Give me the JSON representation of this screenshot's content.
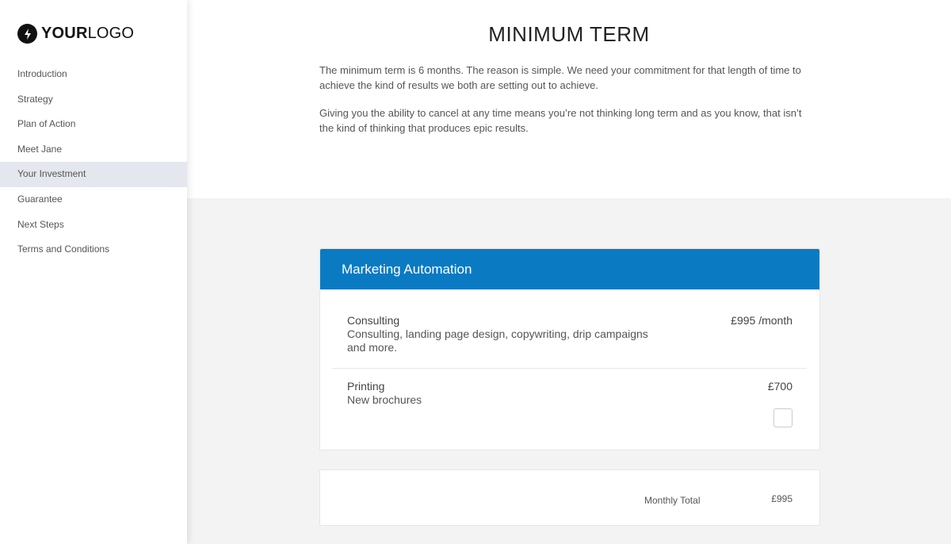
{
  "logo": {
    "icon": "lightning-bolt-icon",
    "bold_text": "YOUR",
    "light_text": "LOGO"
  },
  "sidebar": {
    "active_index": 4,
    "items": [
      {
        "label": "Introduction"
      },
      {
        "label": "Strategy"
      },
      {
        "label": "Plan of Action"
      },
      {
        "label": "Meet Jane"
      },
      {
        "label": "Your Investment"
      },
      {
        "label": "Guarantee"
      },
      {
        "label": "Next Steps"
      },
      {
        "label": "Terms and Conditions"
      }
    ]
  },
  "main": {
    "title": "MINIMUM TERM",
    "paragraphs": [
      "The minimum term is 6 months. The reason is simple. We need your commitment for that length of time to achieve the kind of results we both are setting out to achieve.",
      "Giving you the ability to cancel at any time means you’re not thinking long term and as you know, that isn’t the kind of thinking that produces epic results."
    ]
  },
  "pricing": {
    "header": "Marketing Automation",
    "accent_color": "#0a7ac3",
    "items": [
      {
        "name": "Consulting",
        "description": "Consulting, landing page design, copywriting, drip campaigns and more.",
        "price": "£995 /month"
      },
      {
        "name": "Printing",
        "description": "New brochures",
        "price": "£700",
        "optional": true,
        "checked": false
      }
    ],
    "total_label": "Monthly Total",
    "total_value": "£995"
  }
}
